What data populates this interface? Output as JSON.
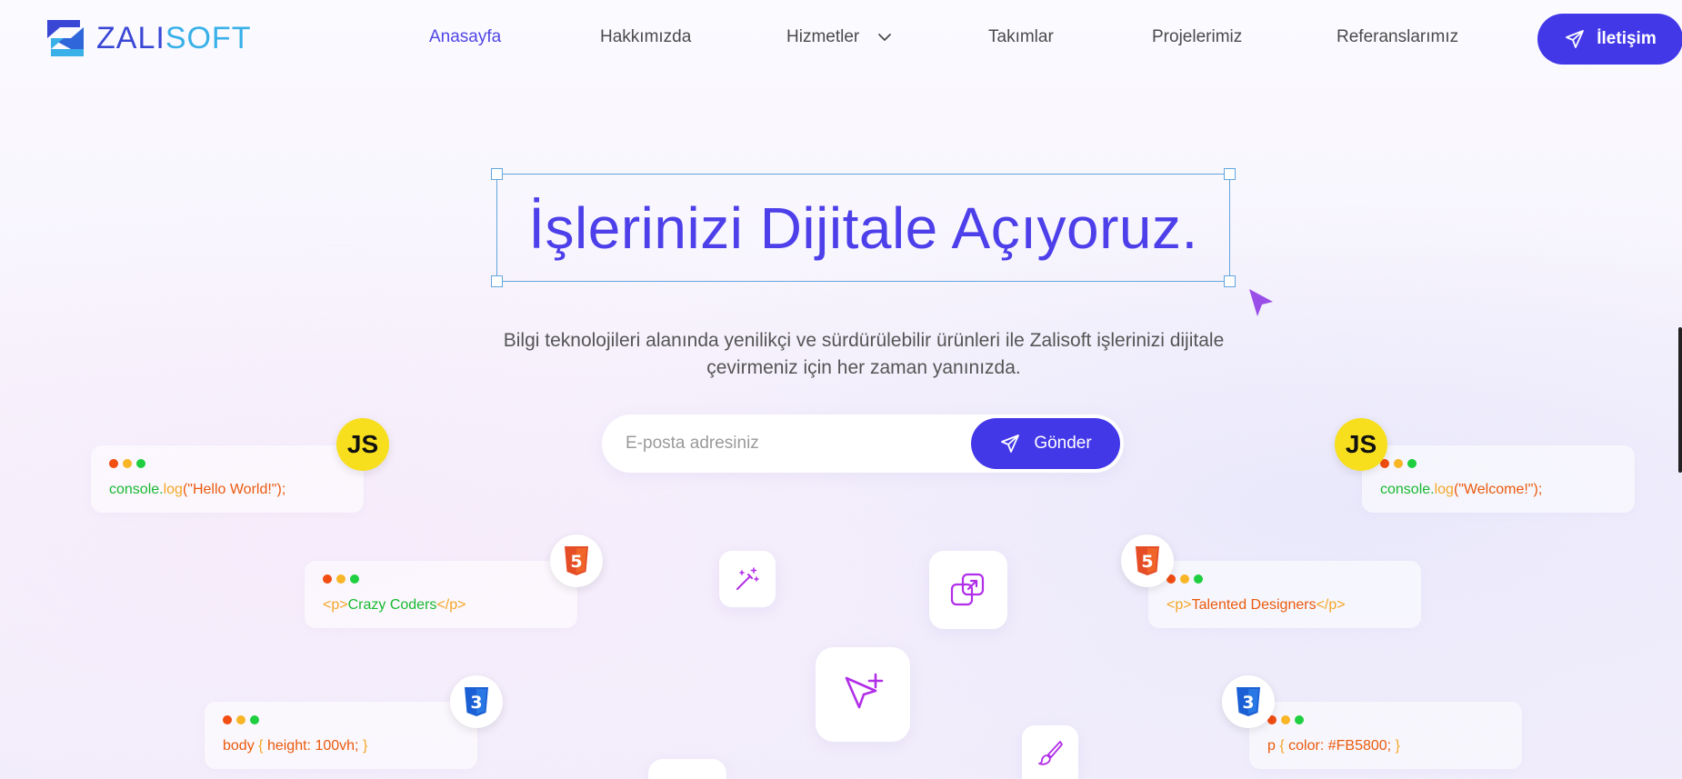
{
  "brand": {
    "part1": "ZALI",
    "part2": "SOFT"
  },
  "nav": {
    "items": [
      {
        "label": "Anasayfa"
      },
      {
        "label": "Hakkımızda"
      },
      {
        "label": "Hizmetler"
      },
      {
        "label": "Takımlar"
      },
      {
        "label": "Projelerimiz"
      },
      {
        "label": "Referanslarımız"
      }
    ],
    "contact_label": "İletişim"
  },
  "hero": {
    "title": "İşlerinizi Dijitale Açıyoruz.",
    "subtitle_line1": "Bilgi teknolojileri alanında yenilikçi ve sürdürülebilir ürünleri ile Zalisoft işlerinizi dijitale",
    "subtitle_line2": "çevirmeniz için her zaman yanınızda."
  },
  "newsletter": {
    "placeholder": "E-posta adresiniz",
    "button_label": "Gönder"
  },
  "cards": {
    "js_left": {
      "obj": "console.",
      "fn": "log",
      "open": "(",
      "str": "\"Hello World!\"",
      "close": ");"
    },
    "js_right": {
      "obj": "console.",
      "fn": "log",
      "open": "(",
      "str": "\"Welcome!\"",
      "close": ");"
    },
    "html_left": {
      "open_tag": "<p>",
      "text": "Crazy Coders",
      "close_tag": "</p>"
    },
    "html_right": {
      "open_tag": "<p>",
      "text": "Talented Designers",
      "close_tag": "</p>"
    },
    "css_left": {
      "selector": "body",
      "lbrace": "{",
      "rule": "height: 100vh;",
      "rbrace": "}"
    },
    "css_right": {
      "selector": "p",
      "lbrace": "{",
      "rule": "color: #FB5800;",
      "rbrace": "}"
    }
  },
  "badges": {
    "js": "JS",
    "html_num": "5",
    "css_num": "3"
  },
  "colors": {
    "accent": "#4338e8",
    "title": "#4d3fe9",
    "icon_purple": "#b12ee8"
  }
}
